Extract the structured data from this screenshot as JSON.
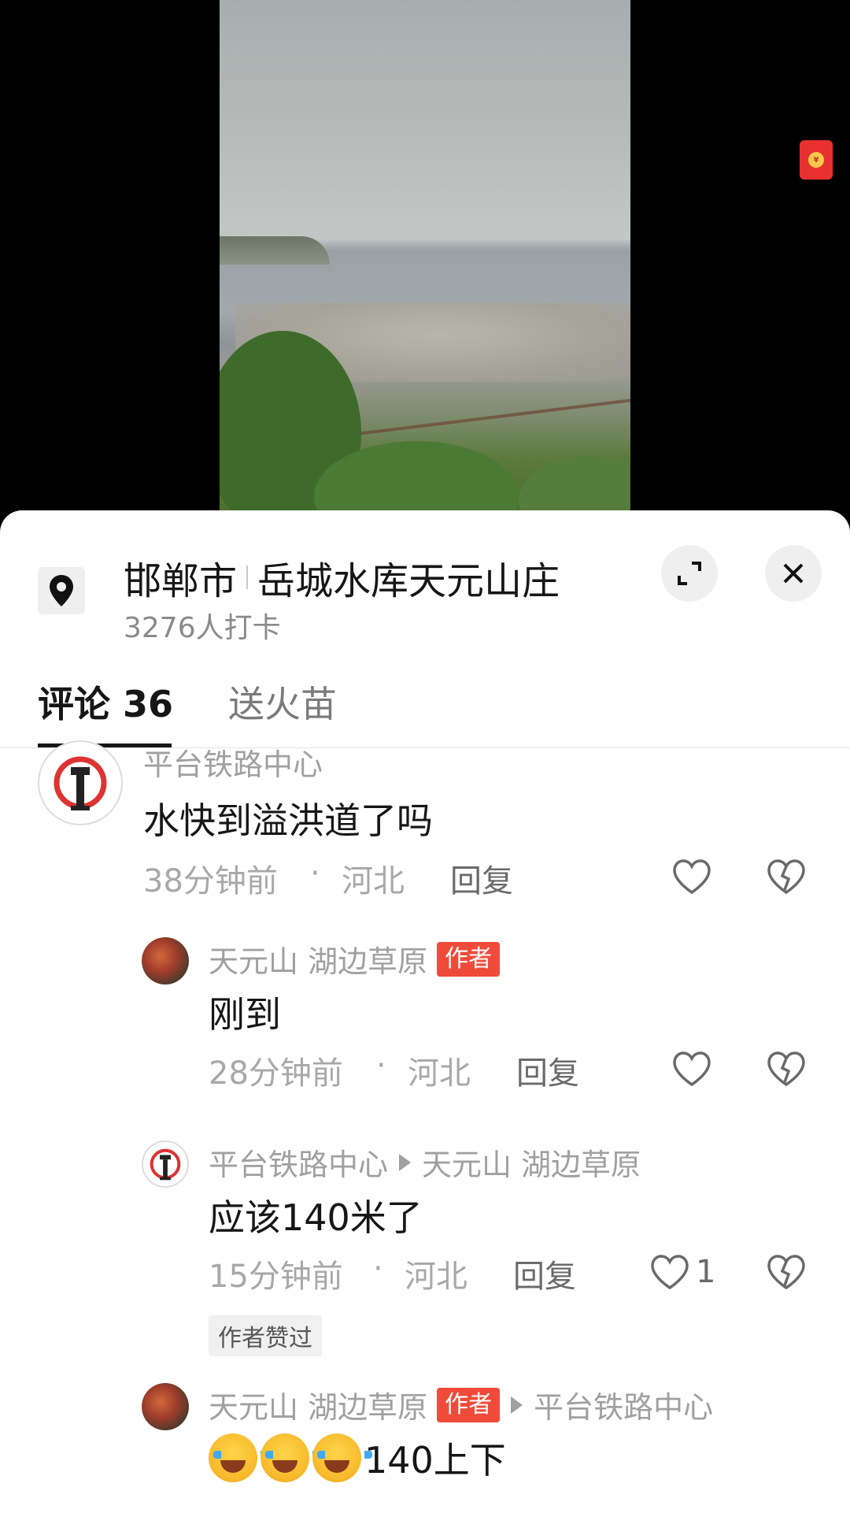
{
  "location": {
    "city": "邯郸市",
    "place": "岳城水库天元山庄",
    "checkins": "3276人打卡"
  },
  "tabs": {
    "comments": "评论 36",
    "gift": "送火苗"
  },
  "comments": [
    {
      "user": "平台铁路中心",
      "text": "水快到溢洪道了吗",
      "time": "38分钟前",
      "region": "河北",
      "reply": "回复"
    },
    {
      "user": "天元山 湖边草原",
      "badge": "作者",
      "text": "刚到",
      "time": "28分钟前",
      "region": "河北",
      "reply": "回复"
    },
    {
      "user": "平台铁路中心",
      "reply_to": "天元山 湖边草原",
      "text": "应该140米了",
      "time": "15分钟前",
      "region": "河北",
      "reply": "回复",
      "likes": "1",
      "liked_tag": "作者赞过"
    },
    {
      "user": "天元山 湖边草原",
      "badge": "作者",
      "reply_to": "平台铁路中心",
      "text": "140上下"
    }
  ],
  "meta_dot": "·",
  "colors": {
    "accent_red": "#f04b3a",
    "redpacket": "#e8312e"
  }
}
